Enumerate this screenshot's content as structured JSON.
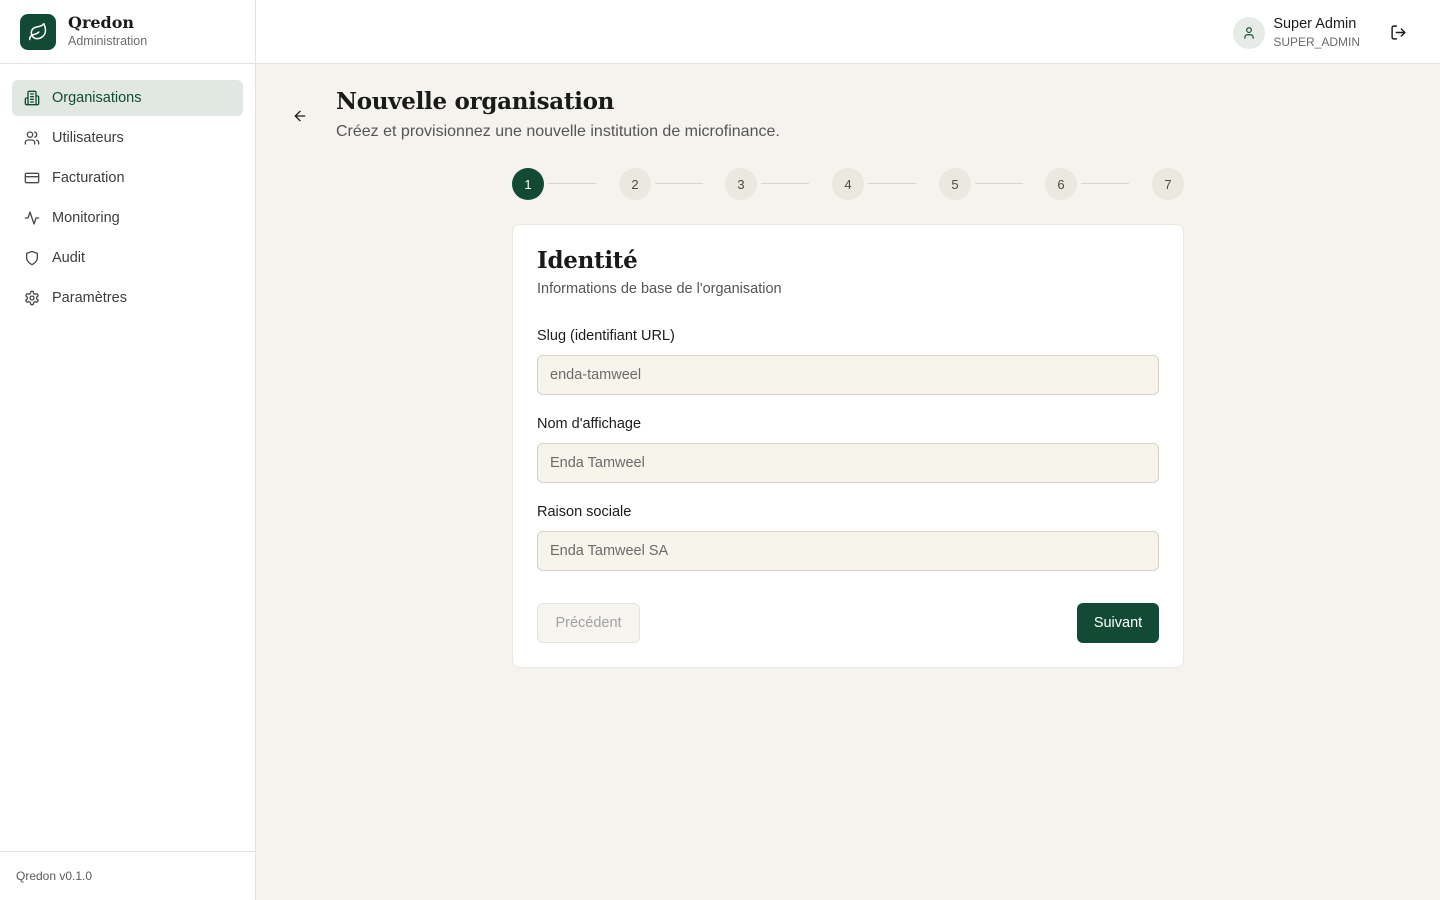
{
  "brand": {
    "name": "Qredon",
    "subtitle": "Administration",
    "icon": "leaf-icon"
  },
  "sidebar": {
    "items": [
      {
        "label": "Organisations",
        "icon": "building-icon",
        "active": true
      },
      {
        "label": "Utilisateurs",
        "icon": "users-icon",
        "active": false
      },
      {
        "label": "Facturation",
        "icon": "credit-card-icon",
        "active": false
      },
      {
        "label": "Monitoring",
        "icon": "activity-icon",
        "active": false
      },
      {
        "label": "Audit",
        "icon": "shield-icon",
        "active": false
      },
      {
        "label": "Paramètres",
        "icon": "gear-icon",
        "active": false
      }
    ],
    "footer": "Qredon v0.1.0"
  },
  "user": {
    "name": "Super Admin",
    "role": "SUPER_ADMIN"
  },
  "header": {
    "title": "Nouvelle organisation",
    "subtitle": "Créez et provisionnez une nouvelle institution de microfinance."
  },
  "stepper": {
    "steps": [
      "1",
      "2",
      "3",
      "4",
      "5",
      "6",
      "7"
    ],
    "current": 1
  },
  "form": {
    "title": "Identité",
    "subtitle": "Informations de base de l'organisation",
    "fields": [
      {
        "label": "Slug (identifiant URL)",
        "value": "",
        "placeholder": "enda-tamweel"
      },
      {
        "label": "Nom d'affichage",
        "value": "",
        "placeholder": "Enda Tamweel"
      },
      {
        "label": "Raison sociale",
        "value": "",
        "placeholder": "Enda Tamweel SA"
      }
    ],
    "prev_label": "Précédent",
    "next_label": "Suivant"
  },
  "colors": {
    "accent": "#124a35",
    "background": "#f5f3ee",
    "active_nav": "#e1e8e3"
  }
}
